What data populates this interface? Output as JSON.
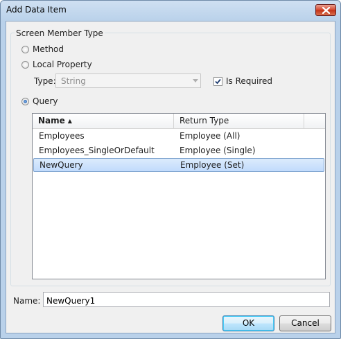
{
  "window": {
    "title": "Add Data Item"
  },
  "group": {
    "legend": "Screen Member Type",
    "options": {
      "method": "Method",
      "local_property": "Local Property",
      "query": "Query"
    },
    "selected": "query"
  },
  "type_field": {
    "label": "Type:",
    "value": "String",
    "disabled": true
  },
  "is_required": {
    "label": "Is Required",
    "checked": true
  },
  "list": {
    "columns": {
      "name": "Name",
      "return_type": "Return Type"
    },
    "sort": "ascending",
    "rows": [
      {
        "name": "Employees",
        "return_type": "Employee (All)"
      },
      {
        "name": "Employees_SingleOrDefault",
        "return_type": "Employee (Single)"
      },
      {
        "name": "NewQuery",
        "return_type": "Employee (Set)",
        "selected": true
      }
    ]
  },
  "name_field": {
    "label": "Name:",
    "value": "NewQuery1"
  },
  "buttons": {
    "ok": "OK",
    "cancel": "Cancel"
  },
  "colors": {
    "selection": "#c1dbfc",
    "accent": "#3c7fb1",
    "close": "#c23016"
  }
}
